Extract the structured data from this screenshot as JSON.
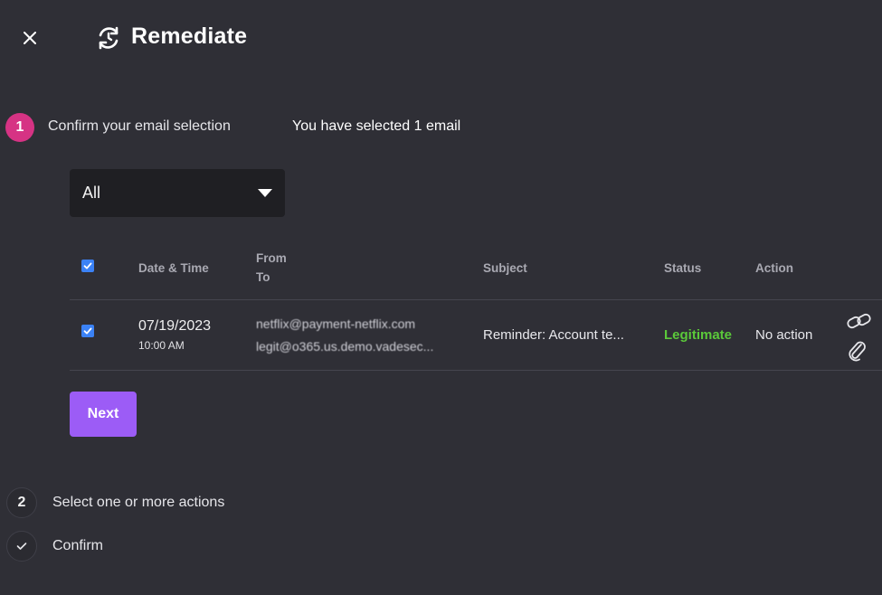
{
  "header": {
    "title": "Remediate",
    "close_icon": "close-icon",
    "title_icon": "remediate-cycle-icon"
  },
  "steps": [
    {
      "number": "1",
      "label": "Confirm your email selection",
      "state": "active"
    },
    {
      "number": "2",
      "label": "Select one or more actions",
      "state": "inactive"
    },
    {
      "number": "✓",
      "label": "Confirm",
      "state": "inactive"
    }
  ],
  "selection_summary": "You have selected 1 email",
  "filter": {
    "value": "All"
  },
  "table": {
    "headers": {
      "date_time": "Date & Time",
      "from": "From",
      "to": "To",
      "subject": "Subject",
      "status": "Status",
      "action": "Action"
    },
    "rows": [
      {
        "date": "07/19/2023",
        "time": "10:00 AM",
        "from": "netflix@payment-netflix.com",
        "to": "legit@o365.us.demo.vadesec...",
        "subject": "Reminder: Account te...",
        "status": "Legitimate",
        "action": "No action",
        "icons": [
          "link-icon",
          "attachment-icon"
        ]
      }
    ]
  },
  "buttons": {
    "next": "Next"
  },
  "colors": {
    "background": "#2f2f36",
    "step_active": "#d63384",
    "next_button": "#9c5cf6",
    "status_legitimate": "#5bc93a",
    "checkbox": "#3b82f6"
  }
}
